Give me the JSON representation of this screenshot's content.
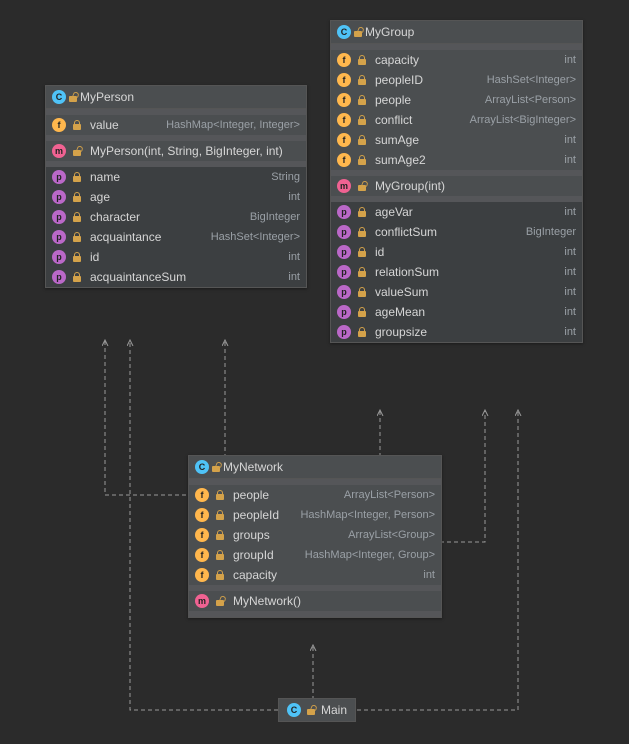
{
  "classes": {
    "myperson": {
      "title": "MyPerson",
      "fields": [
        {
          "name": "value",
          "type": "HashMap<Integer, Integer>"
        }
      ],
      "methods": [
        {
          "sig": "MyPerson(int, String, BigInteger, int)"
        }
      ],
      "properties": [
        {
          "name": "name",
          "type": "String"
        },
        {
          "name": "age",
          "type": "int"
        },
        {
          "name": "character",
          "type": "BigInteger"
        },
        {
          "name": "acquaintance",
          "type": "HashSet<Integer>"
        },
        {
          "name": "id",
          "type": "int"
        },
        {
          "name": "acquaintanceSum",
          "type": "int"
        }
      ]
    },
    "mygroup": {
      "title": "MyGroup",
      "fields": [
        {
          "name": "capacity",
          "type": "int"
        },
        {
          "name": "peopleID",
          "type": "HashSet<Integer>"
        },
        {
          "name": "people",
          "type": "ArrayList<Person>"
        },
        {
          "name": "conflict",
          "type": "ArrayList<BigInteger>"
        },
        {
          "name": "sumAge",
          "type": "int"
        },
        {
          "name": "sumAge2",
          "type": "int"
        }
      ],
      "methods": [
        {
          "sig": "MyGroup(int)"
        }
      ],
      "properties": [
        {
          "name": "ageVar",
          "type": "int"
        },
        {
          "name": "conflictSum",
          "type": "BigInteger"
        },
        {
          "name": "id",
          "type": "int"
        },
        {
          "name": "relationSum",
          "type": "int"
        },
        {
          "name": "valueSum",
          "type": "int"
        },
        {
          "name": "ageMean",
          "type": "int"
        },
        {
          "name": "groupsize",
          "type": "int"
        }
      ]
    },
    "mynetwork": {
      "title": "MyNetwork",
      "fields": [
        {
          "name": "people",
          "type": "ArrayList<Person>"
        },
        {
          "name": "peopleId",
          "type": "HashMap<Integer, Person>"
        },
        {
          "name": "groups",
          "type": "ArrayList<Group>"
        },
        {
          "name": "groupId",
          "type": "HashMap<Integer, Group>"
        },
        {
          "name": "capacity",
          "type": "int"
        }
      ],
      "methods": [
        {
          "sig": "MyNetwork()"
        }
      ]
    },
    "main": {
      "title": "Main"
    }
  }
}
